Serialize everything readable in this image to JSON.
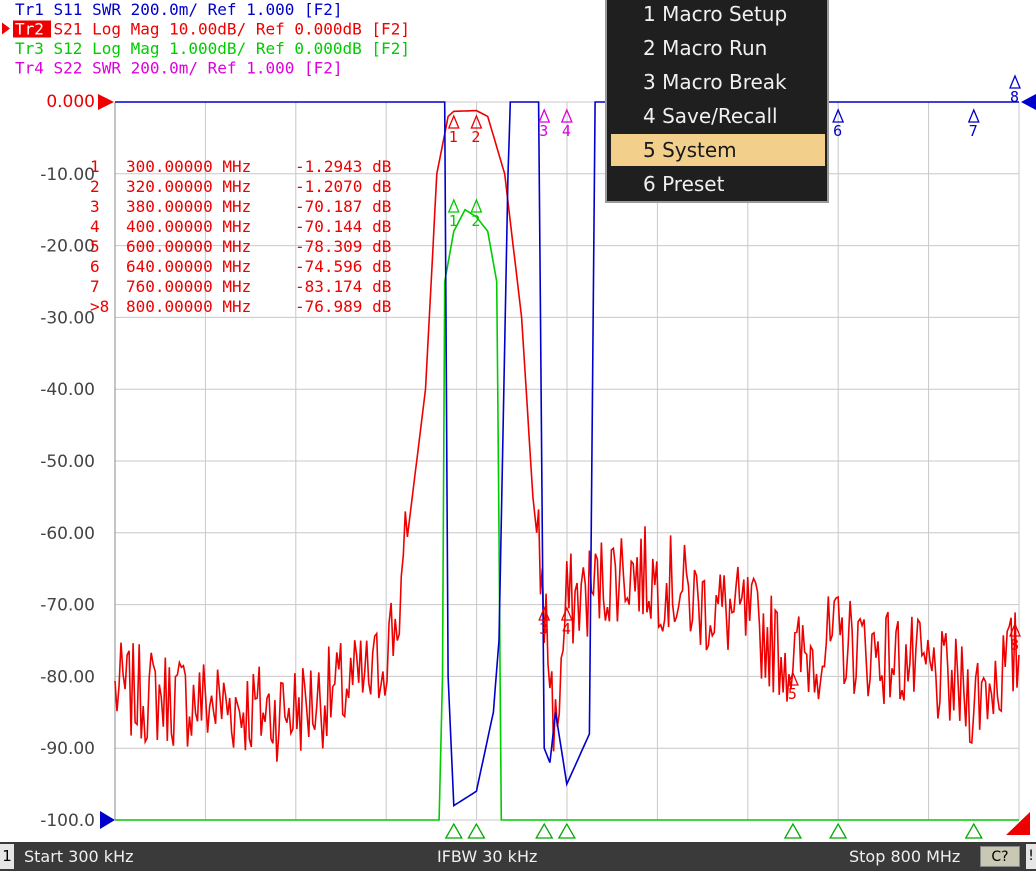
{
  "traces": [
    {
      "id": "tr1",
      "label": "Tr1",
      "param": "S11",
      "format": "SWR",
      "scale": "200.0m/",
      "ref_text": "Ref 1.000",
      "tag": "[F2]",
      "color": "#0000cc",
      "active": false
    },
    {
      "id": "tr2",
      "label": "Tr2",
      "param": "S21",
      "format": "Log Mag",
      "scale": "10.00dB/",
      "ref_text": "Ref 0.000dB",
      "tag": "[F2]",
      "color": "#ee0000",
      "active": true
    },
    {
      "id": "tr3",
      "label": "Tr3",
      "param": "S12",
      "format": "Log Mag",
      "scale": "1.000dB/",
      "ref_text": "Ref 0.000dB",
      "tag": "[F2]",
      "color": "#00cc00",
      "active": false
    },
    {
      "id": "tr4",
      "label": "Tr4",
      "param": "S22",
      "format": "SWR",
      "scale": "200.0m/",
      "ref_text": "Ref 1.000",
      "tag": "[F2]",
      "color": "#dd00dd",
      "active": false
    }
  ],
  "y_axis": {
    "top_label": "0.000",
    "ticks": [
      "-10.00",
      "-20.00",
      "-30.00",
      "-40.00",
      "-50.00",
      "-60.00",
      "-70.00",
      "-80.00",
      "-90.00",
      "-100.0"
    ],
    "min": -100,
    "max": 0
  },
  "markers_table": [
    {
      "num": "1",
      "freq": "300.00000 MHz",
      "value": "-1.2943 dB",
      "active": false
    },
    {
      "num": "2",
      "freq": "320.00000 MHz",
      "value": "-1.2070 dB",
      "active": false
    },
    {
      "num": "3",
      "freq": "380.00000 MHz",
      "value": "-70.187 dB",
      "active": false
    },
    {
      "num": "4",
      "freq": "400.00000 MHz",
      "value": "-70.144 dB",
      "active": false
    },
    {
      "num": "5",
      "freq": "600.00000 MHz",
      "value": "-78.309 dB",
      "active": false
    },
    {
      "num": "6",
      "freq": "640.00000 MHz",
      "value": "-74.596 dB",
      "active": false
    },
    {
      "num": "7",
      "freq": "760.00000 MHz",
      "value": "-83.174 dB",
      "active": false
    },
    {
      "num": "8",
      "freq": "800.00000 MHz",
      "value": "-76.989 dB",
      "active": true
    }
  ],
  "marker_freqs_mhz": [
    300,
    320,
    380,
    400,
    600,
    640,
    760,
    800
  ],
  "menu": {
    "items": [
      {
        "label": "1 Macro Setup",
        "selected": false
      },
      {
        "label": "2 Macro Run",
        "selected": false
      },
      {
        "label": "3 Macro Break",
        "selected": false
      },
      {
        "label": "4 Save/Recall",
        "selected": false
      },
      {
        "label": "5 System",
        "selected": true
      },
      {
        "label": "6 Preset",
        "selected": false
      }
    ]
  },
  "status": {
    "channel": "1",
    "start": "Start 300 kHz",
    "ifbw": "IFBW 30 kHz",
    "stop": "Stop 800 MHz",
    "correction": "C?",
    "extra": "!"
  },
  "chart_data": {
    "type": "line",
    "x_range_mhz": [
      0.3,
      800
    ],
    "ylim": [
      -100,
      0
    ],
    "grid": true,
    "series": [
      {
        "name": "Tr2",
        "color": "#ee0000",
        "x": [
          0.3,
          100,
          140,
          170,
          200,
          230,
          250,
          275,
          285,
          295,
          300,
          320,
          330,
          345,
          360,
          370,
          380,
          390,
          400,
          420,
          450,
          490,
          520,
          560,
          600,
          640,
          700,
          760,
          800
        ],
        "y": [
          -82,
          -84,
          -85,
          -84,
          -82,
          -80,
          -72,
          -40,
          -10,
          -2,
          -1.3,
          -1.2,
          -2,
          -10,
          -30,
          -55,
          -70,
          -88,
          -70,
          -68,
          -65,
          -67,
          -70,
          -72,
          -78,
          -75,
          -78,
          -83,
          -77
        ]
      },
      {
        "name": "Tr3",
        "color": "#00cc00",
        "x": [
          0.3,
          287,
          290,
          292,
          300,
          310,
          320,
          330,
          338,
          340,
          342,
          800
        ],
        "y": [
          -100,
          -100,
          -80,
          -25,
          -18,
          -15,
          -16,
          -18,
          -25,
          -60,
          -100,
          -100
        ]
      },
      {
        "name": "Tr1",
        "color": "#0000cc",
        "x": [
          0.3,
          292,
          295,
          300,
          320,
          335,
          340,
          348,
          350,
          360,
          375,
          380,
          385,
          390,
          400,
          420,
          425,
          800
        ],
        "y": [
          0,
          0,
          -80,
          -98,
          -96,
          -85,
          -75,
          -10,
          0,
          0,
          0,
          -90,
          -92,
          -85,
          -95,
          -88,
          0,
          0
        ]
      }
    ]
  }
}
